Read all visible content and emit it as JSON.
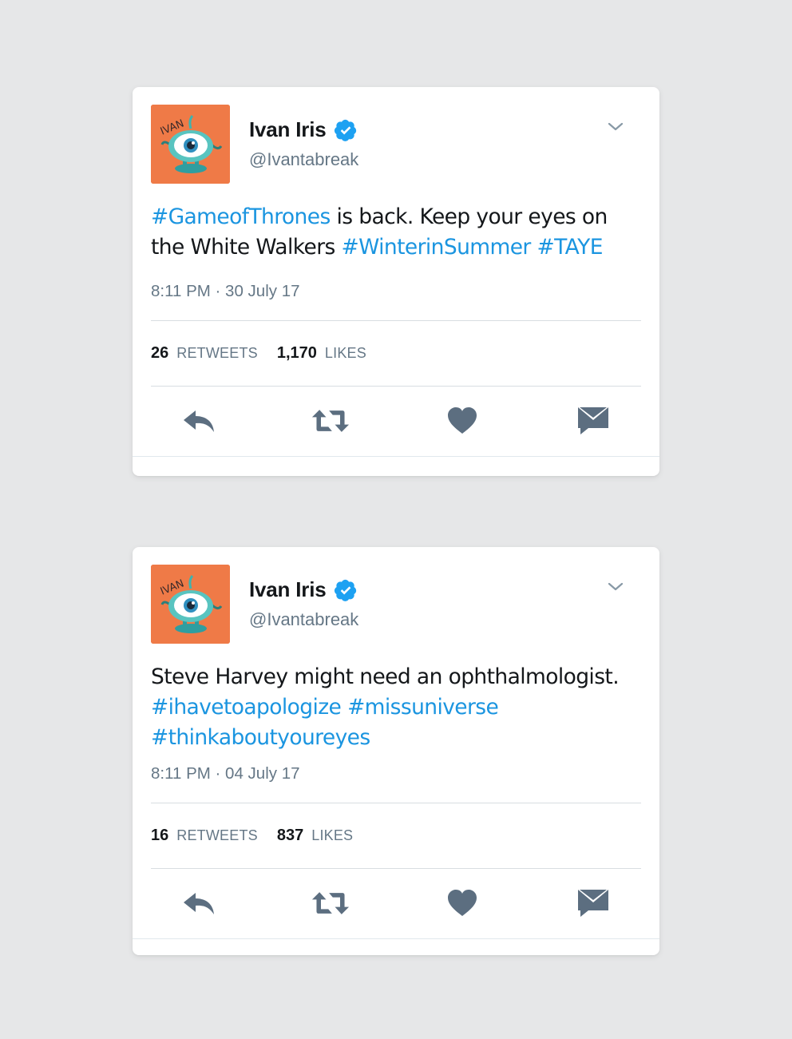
{
  "colors": {
    "background": "#e6e7e8",
    "card": "#ffffff",
    "avatar_bg": "#ef7a47",
    "hashtag": "#1b95e0",
    "verified": "#1da1f2",
    "icon": "#5c6e80"
  },
  "tweets": [
    {
      "avatar_text": "IVAN",
      "name": "Ivan Iris",
      "handle": "@Ivantabreak",
      "text_parts": [
        {
          "text": "#GameofThrones",
          "hashtag": true
        },
        {
          "text": " is back. Keep your eyes on the White Walkers ",
          "hashtag": false
        },
        {
          "text": "#WinterinSummer",
          "hashtag": true
        },
        {
          "text": " ",
          "hashtag": false
        },
        {
          "text": "#TAYE",
          "hashtag": true
        }
      ],
      "timestamp": "8:11 PM · 30 July 17",
      "retweets_count": "26",
      "retweets_label": "RETWEETS",
      "likes_count": "1,170",
      "likes_label": "LIKES",
      "action_icons": [
        "reply-icon",
        "retweet-icon",
        "heart-icon",
        "envelope-icon"
      ]
    },
    {
      "avatar_text": "IVAN",
      "name": "Ivan Iris",
      "handle": "@Ivantabreak",
      "text_parts": [
        {
          "text": "Steve Harvey might need an ophthalmologist. ",
          "hashtag": false
        },
        {
          "text": "#ihavetoapologize",
          "hashtag": true
        },
        {
          "text": " ",
          "hashtag": false
        },
        {
          "text": "#missuniverse",
          "hashtag": true
        },
        {
          "text": " ",
          "hashtag": false
        },
        {
          "text": "#thinkaboutyoureyes",
          "hashtag": true
        }
      ],
      "timestamp": "8:11 PM · 04 July 17",
      "retweets_count": "16",
      "retweets_label": "RETWEETS",
      "likes_count": "837",
      "likes_label": "LIKES",
      "action_icons": [
        "reply-icon",
        "retweet-icon",
        "heart-icon",
        "envelope-icon"
      ]
    }
  ]
}
